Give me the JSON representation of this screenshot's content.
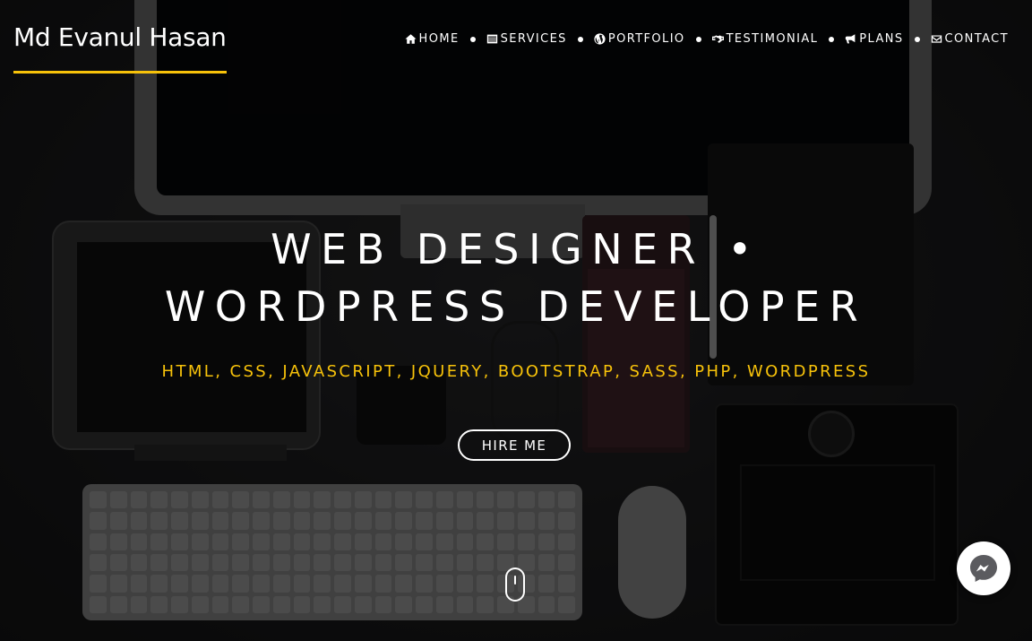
{
  "header": {
    "logo": "Md Evanul Hasan",
    "accent_color": "#f7c20a"
  },
  "nav": {
    "items": [
      {
        "label": "HOME",
        "icon": "home-icon"
      },
      {
        "label": "SERVICES",
        "icon": "list-icon"
      },
      {
        "label": "PORTFOLIO",
        "icon": "wordpress-icon"
      },
      {
        "label": "TESTIMONIAL",
        "icon": "handshake-icon"
      },
      {
        "label": "PLANS",
        "icon": "bullhorn-icon"
      },
      {
        "label": "CONTACT",
        "icon": "envelope-icon"
      }
    ]
  },
  "hero": {
    "title_line1": "WEB DESIGNER •",
    "title_line2": "WORDPRESS DEVELOPER",
    "subtitle": "HTML, CSS, JAVASCRIPT, JQUERY, BOOTSTRAP, SASS, PHP, WORDPRESS",
    "cta_label": "HIRE ME"
  },
  "widgets": {
    "scroll_indicator": "mouse-scroll-icon",
    "chat": "messenger-icon"
  }
}
